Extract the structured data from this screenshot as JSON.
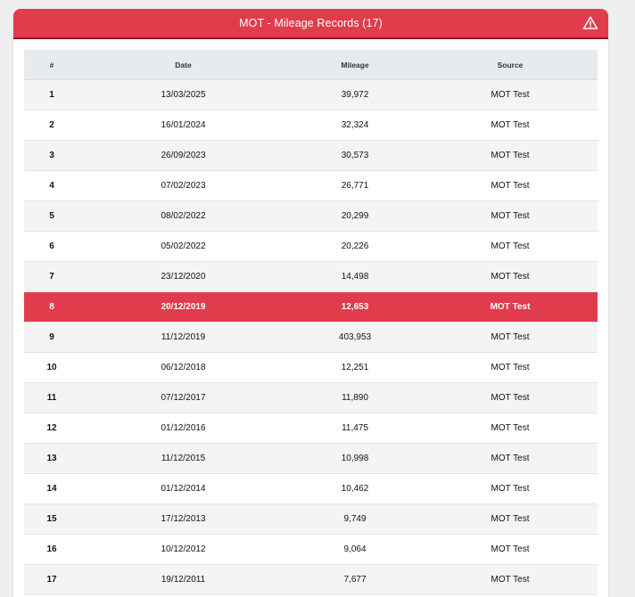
{
  "card": {
    "title": "MOT - Mileage Records (17)",
    "icon": "warning-triangle-icon",
    "accent_color": "#e13c4b"
  },
  "table": {
    "headers": [
      "#",
      "Date",
      "Mileage",
      "Source"
    ],
    "highlight_row": 8,
    "rows": [
      {
        "n": "1",
        "date": "13/03/2025",
        "mileage": "39,972",
        "source": "MOT Test"
      },
      {
        "n": "2",
        "date": "16/01/2024",
        "mileage": "32,324",
        "source": "MOT Test"
      },
      {
        "n": "3",
        "date": "26/09/2023",
        "mileage": "30,573",
        "source": "MOT Test"
      },
      {
        "n": "4",
        "date": "07/02/2023",
        "mileage": "26,771",
        "source": "MOT Test"
      },
      {
        "n": "5",
        "date": "08/02/2022",
        "mileage": "20,299",
        "source": "MOT Test"
      },
      {
        "n": "6",
        "date": "05/02/2022",
        "mileage": "20,226",
        "source": "MOT Test"
      },
      {
        "n": "7",
        "date": "23/12/2020",
        "mileage": "14,498",
        "source": "MOT Test"
      },
      {
        "n": "8",
        "date": "20/12/2019",
        "mileage": "12,653",
        "source": "MOT Test"
      },
      {
        "n": "9",
        "date": "11/12/2019",
        "mileage": "403,953",
        "source": "MOT Test"
      },
      {
        "n": "10",
        "date": "06/12/2018",
        "mileage": "12,251",
        "source": "MOT Test"
      },
      {
        "n": "11",
        "date": "07/12/2017",
        "mileage": "11,890",
        "source": "MOT Test"
      },
      {
        "n": "12",
        "date": "01/12/2016",
        "mileage": "11,475",
        "source": "MOT Test"
      },
      {
        "n": "13",
        "date": "11/12/2015",
        "mileage": "10,998",
        "source": "MOT Test"
      },
      {
        "n": "14",
        "date": "01/12/2014",
        "mileage": "10,462",
        "source": "MOT Test"
      },
      {
        "n": "15",
        "date": "17/12/2013",
        "mileage": "9,749",
        "source": "MOT Test"
      },
      {
        "n": "16",
        "date": "10/12/2012",
        "mileage": "9,064",
        "source": "MOT Test"
      },
      {
        "n": "17",
        "date": "19/12/2011",
        "mileage": "7,677",
        "source": "MOT Test"
      }
    ]
  }
}
